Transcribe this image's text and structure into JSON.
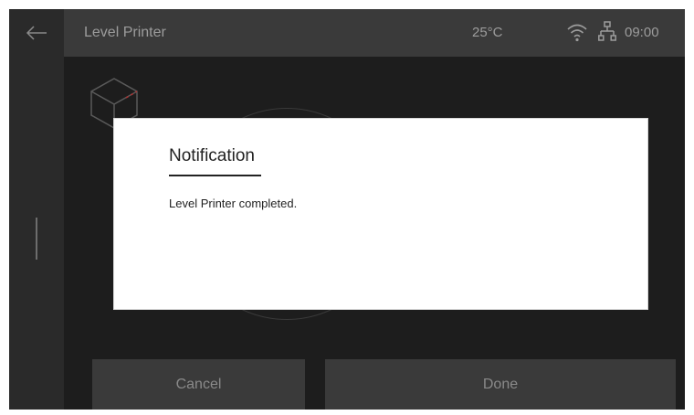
{
  "header": {
    "title": "Level Printer",
    "temperature": "25°C",
    "time": "09:00"
  },
  "icons": {
    "back": "back-arrow-icon",
    "wifi": "wifi-icon",
    "network": "network-icon",
    "model": "cube-icon"
  },
  "actions": {
    "cancel_label": "Cancel",
    "done_label": "Done"
  },
  "dialog": {
    "title": "Notification",
    "message": "Level Printer completed."
  },
  "colors": {
    "screen_bg": "#1d1d1d",
    "topbar_bg": "#3a3a3a",
    "sidebar_bg": "#2a2a2a",
    "dialog_bg": "#ffffff"
  }
}
